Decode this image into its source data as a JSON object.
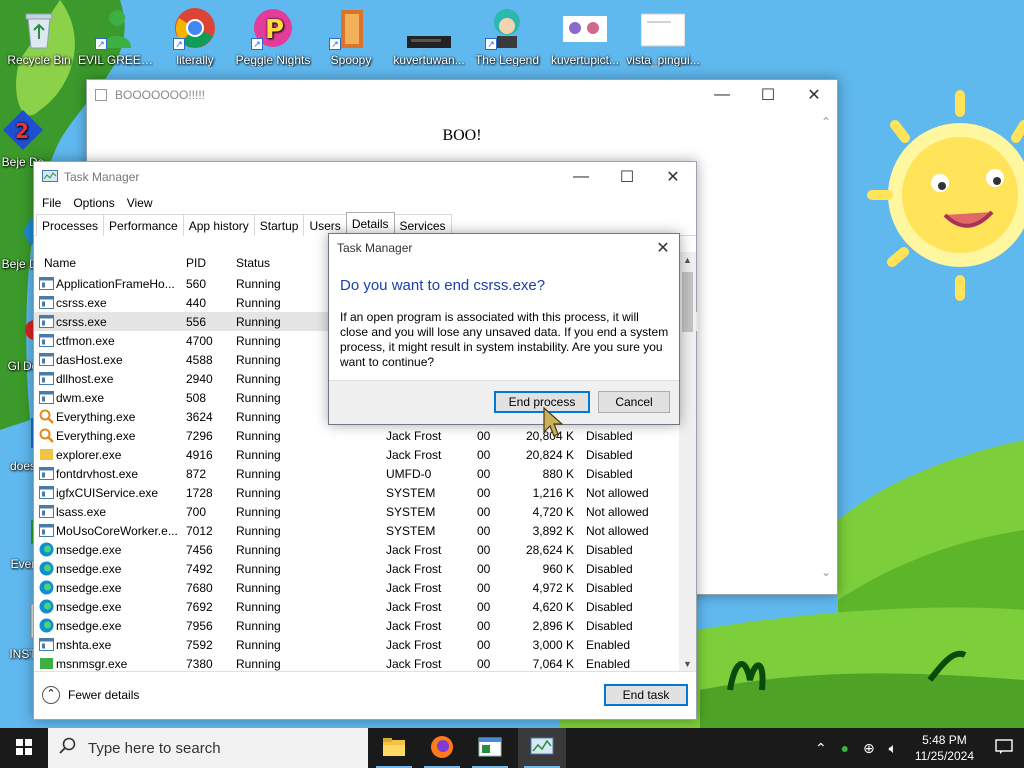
{
  "desktop": {
    "icons": [
      {
        "label": "Recycle Bin"
      },
      {
        "label": "EVIL GREEN MEN GO"
      },
      {
        "label": "literally"
      },
      {
        "label": "Peggle Nights"
      },
      {
        "label": "Spoopy"
      },
      {
        "label": "kuvertuwan..."
      },
      {
        "label": "The Legend"
      },
      {
        "label": "kuvertupict..."
      },
      {
        "label": "vista_pingui..."
      }
    ],
    "left_column": [
      {
        "label": "Beje De"
      },
      {
        "label": "Beje De"
      },
      {
        "label": "Gl De"
      },
      {
        "label": "does"
      },
      {
        "label": "Ever"
      },
      {
        "label": "INST"
      }
    ]
  },
  "boo_window": {
    "title": "BOOOOOOO!!!!!",
    "body_text": "BOO!"
  },
  "task_manager": {
    "title": "Task Manager",
    "menu": [
      "File",
      "Options",
      "View"
    ],
    "tabs": [
      "Processes",
      "Performance",
      "App history",
      "Startup",
      "Users",
      "Details",
      "Services"
    ],
    "active_tab": "Details",
    "columns": [
      "Name",
      "PID",
      "Status"
    ],
    "rows": [
      {
        "name": "ApplicationFrameHo...",
        "pid": "560",
        "status": "Running",
        "user": "",
        "cpu": "",
        "mem": "",
        "uac": ""
      },
      {
        "name": "csrss.exe",
        "pid": "440",
        "status": "Running",
        "user": "",
        "cpu": "",
        "mem": "",
        "uac": ""
      },
      {
        "name": "csrss.exe",
        "pid": "556",
        "status": "Running",
        "user": "",
        "cpu": "",
        "mem": "",
        "uac": ""
      },
      {
        "name": "ctfmon.exe",
        "pid": "4700",
        "status": "Running",
        "user": "",
        "cpu": "",
        "mem": "",
        "uac": ""
      },
      {
        "name": "dasHost.exe",
        "pid": "4588",
        "status": "Running",
        "user": "",
        "cpu": "",
        "mem": "",
        "uac": ""
      },
      {
        "name": "dllhost.exe",
        "pid": "2940",
        "status": "Running",
        "user": "",
        "cpu": "",
        "mem": "",
        "uac": ""
      },
      {
        "name": "dwm.exe",
        "pid": "508",
        "status": "Running",
        "user": "",
        "cpu": "",
        "mem": "",
        "uac": ""
      },
      {
        "name": "Everything.exe",
        "pid": "3624",
        "status": "Running",
        "user": "",
        "cpu": "",
        "mem": "",
        "uac": ""
      },
      {
        "name": "Everything.exe",
        "pid": "7296",
        "status": "Running",
        "user": "Jack Frost",
        "cpu": "00",
        "mem": "20,804 K",
        "uac": "Disabled"
      },
      {
        "name": "explorer.exe",
        "pid": "4916",
        "status": "Running",
        "user": "Jack Frost",
        "cpu": "00",
        "mem": "20,824 K",
        "uac": "Disabled"
      },
      {
        "name": "fontdrvhost.exe",
        "pid": "872",
        "status": "Running",
        "user": "UMFD-0",
        "cpu": "00",
        "mem": "880 K",
        "uac": "Disabled"
      },
      {
        "name": "igfxCUIService.exe",
        "pid": "1728",
        "status": "Running",
        "user": "SYSTEM",
        "cpu": "00",
        "mem": "1,216 K",
        "uac": "Not allowed"
      },
      {
        "name": "lsass.exe",
        "pid": "700",
        "status": "Running",
        "user": "SYSTEM",
        "cpu": "00",
        "mem": "4,720 K",
        "uac": "Not allowed"
      },
      {
        "name": "MoUsoCoreWorker.e...",
        "pid": "7012",
        "status": "Running",
        "user": "SYSTEM",
        "cpu": "00",
        "mem": "3,892 K",
        "uac": "Not allowed"
      },
      {
        "name": "msedge.exe",
        "pid": "7456",
        "status": "Running",
        "user": "Jack Frost",
        "cpu": "00",
        "mem": "28,624 K",
        "uac": "Disabled"
      },
      {
        "name": "msedge.exe",
        "pid": "7492",
        "status": "Running",
        "user": "Jack Frost",
        "cpu": "00",
        "mem": "960 K",
        "uac": "Disabled"
      },
      {
        "name": "msedge.exe",
        "pid": "7680",
        "status": "Running",
        "user": "Jack Frost",
        "cpu": "00",
        "mem": "4,972 K",
        "uac": "Disabled"
      },
      {
        "name": "msedge.exe",
        "pid": "7692",
        "status": "Running",
        "user": "Jack Frost",
        "cpu": "00",
        "mem": "4,620 K",
        "uac": "Disabled"
      },
      {
        "name": "msedge.exe",
        "pid": "7956",
        "status": "Running",
        "user": "Jack Frost",
        "cpu": "00",
        "mem": "2,896 K",
        "uac": "Disabled"
      },
      {
        "name": "mshta.exe",
        "pid": "7592",
        "status": "Running",
        "user": "Jack Frost",
        "cpu": "00",
        "mem": "3,000 K",
        "uac": "Enabled"
      },
      {
        "name": "msnmsgr.exe",
        "pid": "7380",
        "status": "Running",
        "user": "Jack Frost",
        "cpu": "00",
        "mem": "7,064 K",
        "uac": "Enabled"
      }
    ],
    "selected_row": 2,
    "fewer_details": "Fewer details",
    "end_task": "End task"
  },
  "dialog": {
    "title": "Task Manager",
    "question": "Do you want to end csrss.exe?",
    "message": "If an open program is associated with this process, it will close and you will lose any unsaved data. If you end a system process, it might result in system instability. Are you sure you want to continue?",
    "end_process": "End process",
    "cancel": "Cancel"
  },
  "taskbar": {
    "search_placeholder": "Type here to search",
    "time": "5:48 PM",
    "date": "11/25/2024"
  }
}
